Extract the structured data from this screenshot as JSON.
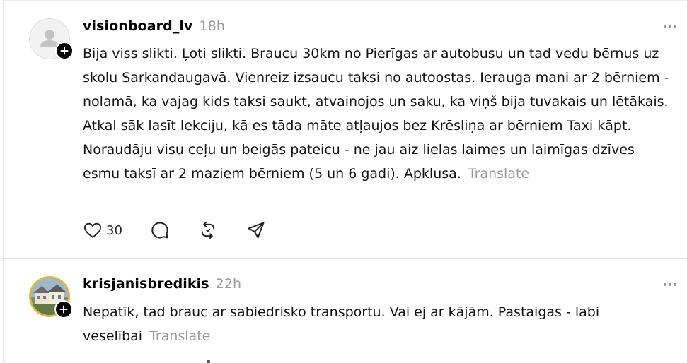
{
  "posts": [
    {
      "username": "visionboard_lv",
      "time": "18h",
      "avatar_icon": "default-person-icon",
      "text": "Bija viss slikti. Ļoti slikti. Braucu 30km no Pierīgas ar autobusu un tad vedu bērnus uz skolu Sarkandaugavā. Vienreiz izsaucu taksi no autoostas. Ierauga mani ar 2 bērniem - nolamā, ka vajag kids taksi saukt, atvainojos un saku, ka viņš bija tuvakais un lētākais. Atkal sāk lasīt lekciju, kā es tāda māte atļaujos bez Krēsliņa ar bērniem Taxi kāpt. Noraudāju visu ceļu un beigās pateicu - ne jau aiz lielas laimes un laimīgas dzīves esmu taksī ar 2 maziem bērniem (5 un 6 gadi). Apklusa.",
      "translate": "Translate",
      "likes": "30"
    },
    {
      "username": "krisjanisbredikis",
      "time": "22h",
      "avatar_icon": "profile-photo-house",
      "text": "Nepatīk, tad brauc ar sabiedrisko transportu. Vai ej ar kājām. Pastaigas - labi veselībai",
      "translate": "Translate"
    }
  ],
  "colors": {
    "meta_gray": "#999999",
    "divider": "#e0e0e0",
    "badge": "#000000"
  }
}
